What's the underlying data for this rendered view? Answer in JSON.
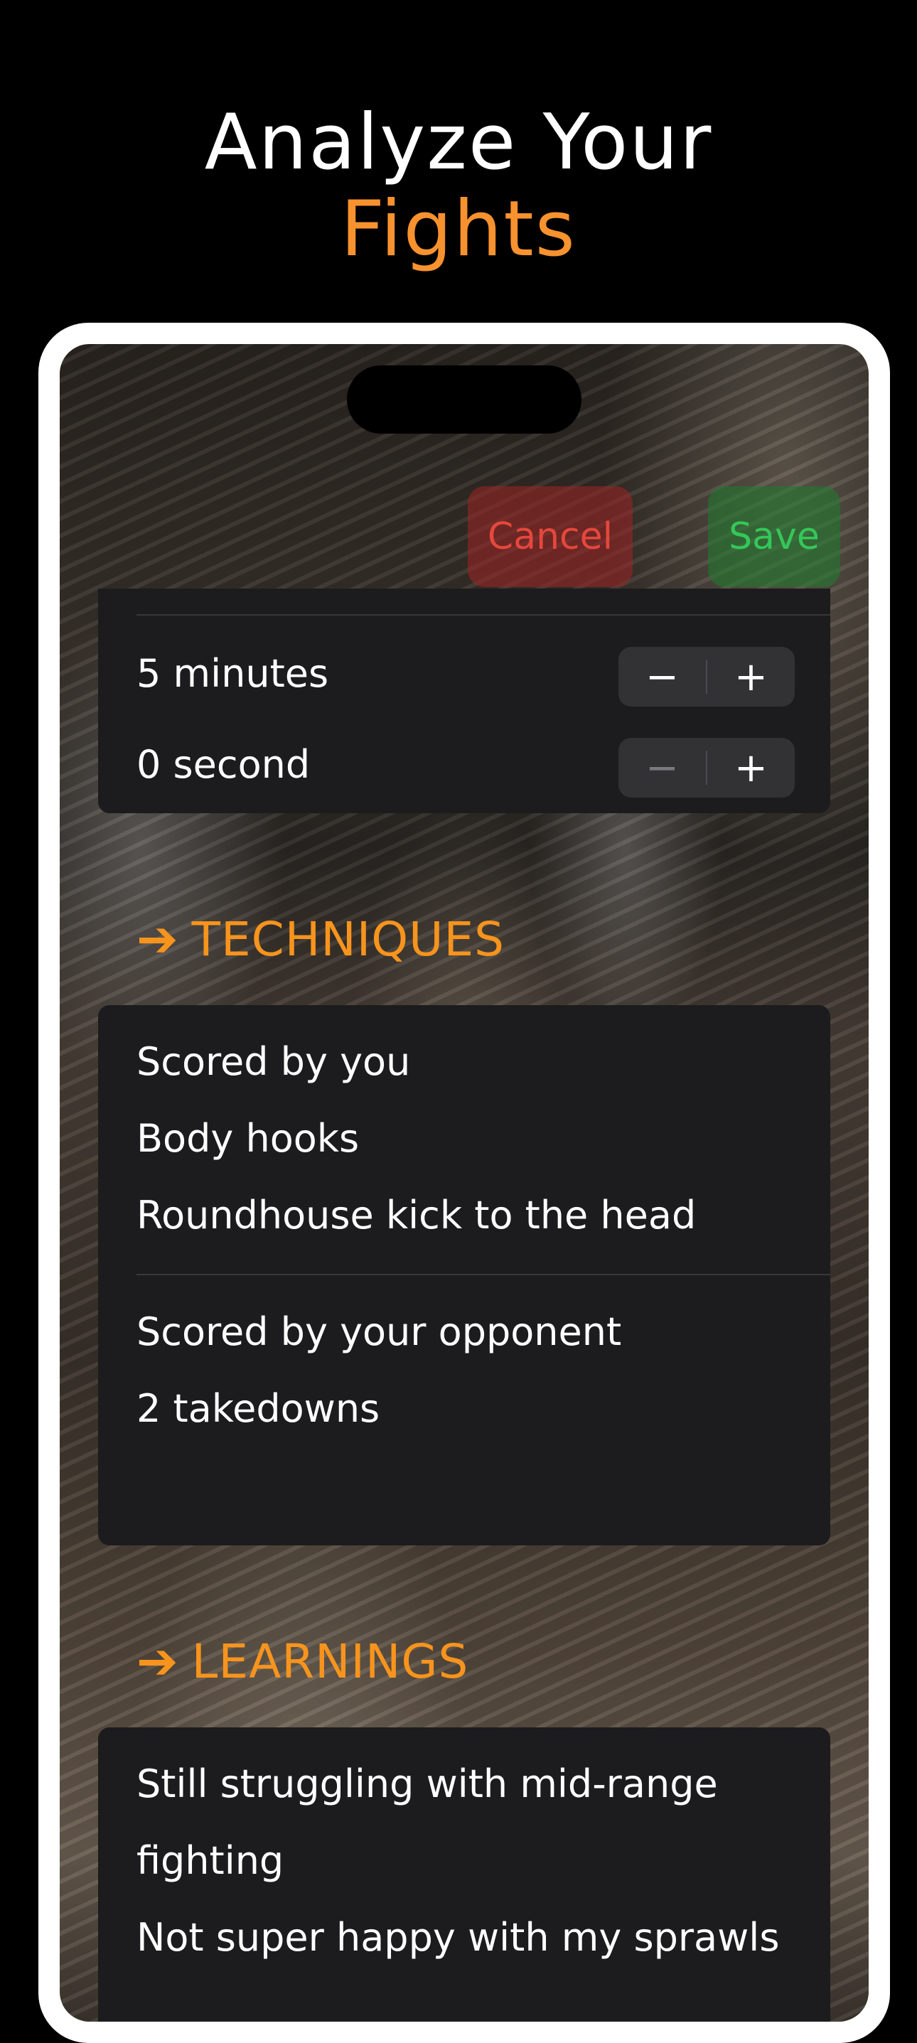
{
  "headline": {
    "line1": "Analyze Your",
    "line2": "Fights"
  },
  "colors": {
    "accent": "#f7922f",
    "cancel": "#e5473d",
    "save": "#34c759",
    "card": "#1c1c1e"
  },
  "toolbar": {
    "cancel_label": "Cancel",
    "save_label": "Save"
  },
  "timer": {
    "minutes": {
      "label": "5 minutes",
      "decrement": "−",
      "increment": "+"
    },
    "seconds": {
      "label": "0 second",
      "decrement": "−",
      "increment": "+"
    }
  },
  "techniques": {
    "arrow_icon": "arrow-right-icon",
    "arrow": "➔",
    "title": "TECHNIQUES",
    "scored_by_you": {
      "heading": "Scored by you",
      "items": [
        "Body hooks",
        "Roundhouse kick to the head"
      ]
    },
    "scored_by_opponent": {
      "heading": "Scored by your opponent",
      "items": [
        "2 takedowns"
      ]
    }
  },
  "learnings": {
    "arrow": "➔",
    "title": "LEARNINGS",
    "lines": [
      "Still struggling with mid-range",
      "fighting",
      "Not super happy with my sprawls"
    ]
  }
}
